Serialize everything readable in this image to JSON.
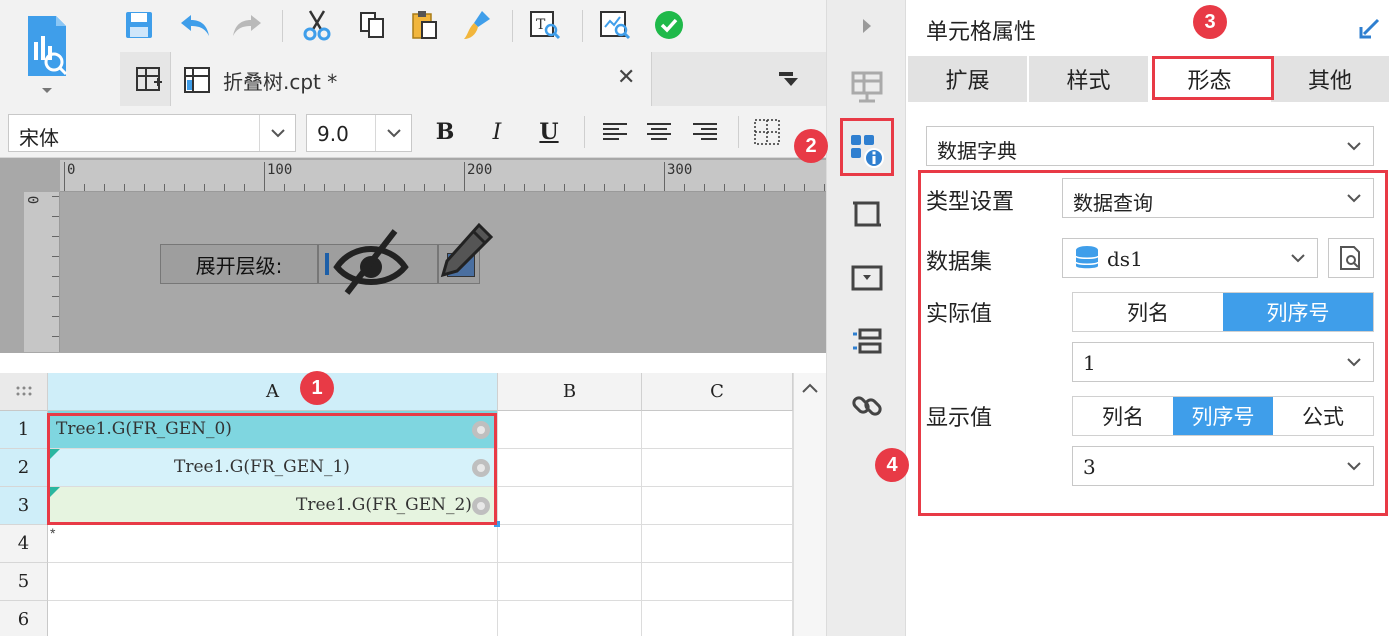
{
  "file_tab": {
    "name": "折叠树.cpt *",
    "close": "✕"
  },
  "font_row": {
    "font_name": "宋体",
    "font_size": "9.0",
    "bold": "B",
    "italic": "I",
    "underline": "U"
  },
  "ruler": {
    "h_labels": [
      "0",
      "100",
      "200",
      "300"
    ],
    "v_labels": [
      "0"
    ]
  },
  "param_panel": {
    "label": "展开层级:"
  },
  "grid": {
    "columns": [
      "A",
      "B",
      "C"
    ],
    "rows": [
      "1",
      "2",
      "3",
      "4",
      "5",
      "6"
    ],
    "cells": [
      "Tree1.G(FR_GEN_0)",
      "Tree1.G(FR_GEN_1)",
      "Tree1.G(FR_GEN_2)"
    ],
    "cursor_mark": "*"
  },
  "props": {
    "title": "单元格属性",
    "tabs": [
      "扩展",
      "样式",
      "形态",
      "其他"
    ],
    "active_tab": "形态",
    "widget_type": "数据字典",
    "type_label": "类型设置",
    "type_value": "数据查询",
    "dataset_label": "数据集",
    "dataset_value": "ds1",
    "actual_label": "实际值",
    "actual_options": [
      "列名",
      "列序号"
    ],
    "actual_selected": "列序号",
    "actual_index": "1",
    "display_label": "显示值",
    "display_options": [
      "列名",
      "列序号",
      "公式"
    ],
    "display_selected": "列序号",
    "display_index": "3"
  },
  "annotations": {
    "b1": "1",
    "b2": "2",
    "b3": "3",
    "b4": "4"
  },
  "colors": {
    "accent": "#3f9eea",
    "annotation": "#e83a46",
    "tree_row1": "#7fd6e0",
    "tree_row2": "#d6f2fa",
    "tree_row3": "#e6f4e0"
  }
}
